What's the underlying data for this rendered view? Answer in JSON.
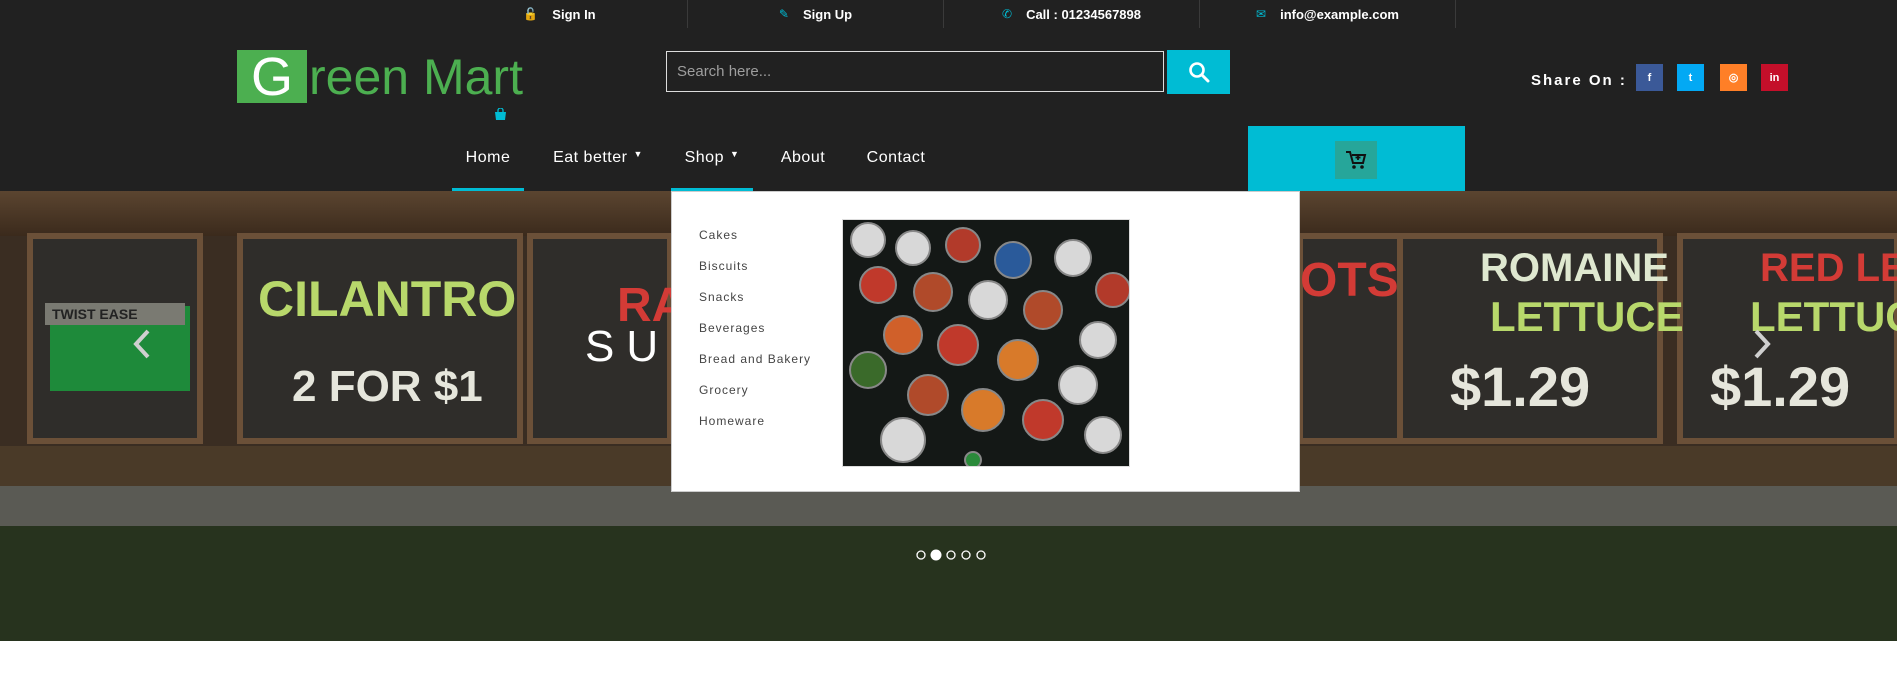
{
  "topbar": {
    "items": [
      {
        "icon": "lock-open-icon",
        "label": "Sign In"
      },
      {
        "icon": "edit-icon",
        "label": "Sign Up"
      },
      {
        "icon": "phone-icon",
        "label": "Call : 01234567898"
      },
      {
        "icon": "envelope-icon",
        "label": "info@example.com"
      }
    ]
  },
  "logo": {
    "first_letter": "G",
    "rest": "reen Mart"
  },
  "search": {
    "placeholder": "Search here...",
    "value": ""
  },
  "share": {
    "label": "Share On :",
    "networks": [
      {
        "icon": "facebook-icon",
        "glyph": "f",
        "color": "#3b5998"
      },
      {
        "icon": "twitter-icon",
        "glyph": "t",
        "color": "#03a9f4"
      },
      {
        "icon": "instagram-icon",
        "glyph": "◎",
        "color": "#ff7f27"
      },
      {
        "icon": "linkedin-icon",
        "glyph": "in",
        "color": "#c40f2a"
      }
    ]
  },
  "nav": {
    "items": [
      {
        "label": "Home"
      },
      {
        "label": "Eat better"
      },
      {
        "label": "Shop"
      },
      {
        "label": "About"
      },
      {
        "label": "Contact"
      }
    ]
  },
  "dropdown": {
    "items": [
      "Cakes",
      "Biscuits",
      "Snacks",
      "Beverages",
      "Bread and Bakery",
      "Grocery",
      "Homeware"
    ]
  },
  "hero": {
    "caption": "SU",
    "chalkboards": [
      "CILANTRO",
      "2 FOR $1",
      "RA",
      "OTS",
      "ROMAINE",
      "LETTUCE",
      "$1.29",
      "RED LEA",
      "LETTUC",
      "TWIST EASE"
    ],
    "indicator_count": 5,
    "active_indicator": 2
  },
  "colors": {
    "accent": "#00bcd4",
    "brand": "#4caf50",
    "header_bg": "#212121"
  }
}
